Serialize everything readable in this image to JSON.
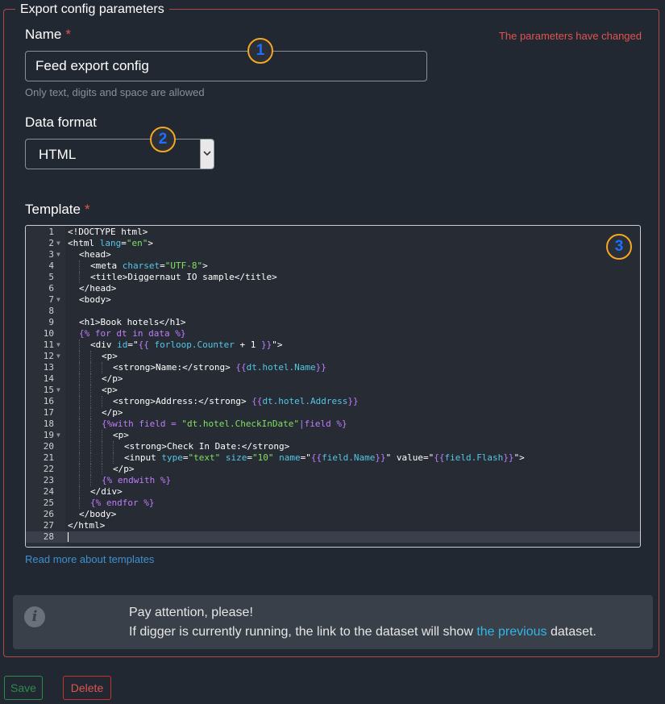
{
  "form": {
    "legend": "Export config parameters",
    "name_label": "Name",
    "required_mark": "*",
    "changed_notice": "The parameters have changed",
    "name_value": "Feed export config",
    "name_hint": "Only text, digits and space are allowed",
    "format_label": "Data format",
    "format_value": "HTML",
    "template_label": "Template",
    "read_more": "Read more about templates"
  },
  "badges": [
    "1",
    "2",
    "3"
  ],
  "editor": {
    "lines": [
      {
        "n": "1",
        "fold": false,
        "indent": 0,
        "parts": [
          [
            "&lt;!DOCTYPE html&gt;",
            ""
          ]
        ]
      },
      {
        "n": "2",
        "fold": true,
        "indent": 0,
        "parts": [
          [
            "<html ",
            ""
          ],
          [
            "lang",
            "attr"
          ],
          [
            "=",
            ""
          ],
          [
            "\"en\"",
            "str"
          ],
          [
            ">",
            ""
          ]
        ]
      },
      {
        "n": "3",
        "fold": true,
        "indent": 1,
        "parts": [
          [
            "<head>",
            ""
          ]
        ]
      },
      {
        "n": "4",
        "fold": false,
        "indent": 2,
        "parts": [
          [
            "<meta ",
            ""
          ],
          [
            "charset",
            "attr"
          ],
          [
            "=",
            ""
          ],
          [
            "\"UTF-8\"",
            "str"
          ],
          [
            ">",
            ""
          ]
        ]
      },
      {
        "n": "5",
        "fold": false,
        "indent": 2,
        "parts": [
          [
            "<title>Diggernaut IO sample</title>",
            ""
          ]
        ]
      },
      {
        "n": "6",
        "fold": false,
        "indent": 1,
        "parts": [
          [
            "</head>",
            ""
          ]
        ]
      },
      {
        "n": "7",
        "fold": true,
        "indent": 1,
        "parts": [
          [
            "<body>",
            ""
          ]
        ]
      },
      {
        "n": "8",
        "fold": false,
        "indent": 0,
        "parts": []
      },
      {
        "n": "9",
        "fold": false,
        "indent": 1,
        "parts": [
          [
            "<h1>Book hotels</h1>",
            ""
          ]
        ]
      },
      {
        "n": "10",
        "fold": false,
        "indent": 1,
        "parts": [
          [
            "{% for dt in data %}",
            "tpl"
          ]
        ]
      },
      {
        "n": "11",
        "fold": true,
        "indent": 2,
        "parts": [
          [
            "<div ",
            ""
          ],
          [
            "id",
            "attr"
          ],
          [
            "=\"",
            ""
          ],
          [
            "{{ ",
            "tpl"
          ],
          [
            "forloop.Counter",
            "var"
          ],
          [
            " + 1 ",
            ""
          ],
          [
            "}}",
            "tpl"
          ],
          [
            "\">",
            ""
          ]
        ]
      },
      {
        "n": "12",
        "fold": true,
        "indent": 3,
        "parts": [
          [
            "<p>",
            ""
          ]
        ]
      },
      {
        "n": "13",
        "fold": false,
        "indent": 4,
        "parts": [
          [
            "<strong>Name:</strong> ",
            ""
          ],
          [
            "{{",
            "tpl"
          ],
          [
            "dt.hotel.Name",
            "var"
          ],
          [
            "}}",
            "tpl"
          ]
        ]
      },
      {
        "n": "14",
        "fold": false,
        "indent": 3,
        "parts": [
          [
            "</p>",
            ""
          ]
        ]
      },
      {
        "n": "15",
        "fold": true,
        "indent": 3,
        "parts": [
          [
            "<p>",
            ""
          ]
        ]
      },
      {
        "n": "16",
        "fold": false,
        "indent": 4,
        "parts": [
          [
            "<strong>Address:</strong> ",
            ""
          ],
          [
            "{{",
            "tpl"
          ],
          [
            "dt.hotel.Address",
            "var"
          ],
          [
            "}}",
            "tpl"
          ]
        ]
      },
      {
        "n": "17",
        "fold": false,
        "indent": 3,
        "parts": [
          [
            "</p>",
            ""
          ]
        ]
      },
      {
        "n": "18",
        "fold": false,
        "indent": 3,
        "parts": [
          [
            "{%with field = ",
            "tpl"
          ],
          [
            "\"dt.hotel.CheckInDate\"",
            "str"
          ],
          [
            "|field %}",
            "tpl"
          ]
        ]
      },
      {
        "n": "19",
        "fold": true,
        "indent": 4,
        "parts": [
          [
            "<p>",
            ""
          ]
        ]
      },
      {
        "n": "20",
        "fold": false,
        "indent": 5,
        "parts": [
          [
            "<strong>Check In Date:</strong>",
            ""
          ]
        ]
      },
      {
        "n": "21",
        "fold": false,
        "indent": 5,
        "parts": [
          [
            "<input ",
            ""
          ],
          [
            "type",
            "attr"
          ],
          [
            "=",
            ""
          ],
          [
            "\"text\"",
            "str"
          ],
          [
            " ",
            ""
          ],
          [
            "size",
            "attr"
          ],
          [
            "=",
            ""
          ],
          [
            "\"10\"",
            "str"
          ],
          [
            " ",
            ""
          ],
          [
            "name",
            "attr"
          ],
          [
            "=\"",
            ""
          ],
          [
            "{{",
            "tpl"
          ],
          [
            "field.Name",
            "var"
          ],
          [
            "}}",
            "tpl"
          ],
          [
            "\" value=\"",
            ""
          ],
          [
            "{{",
            "tpl"
          ],
          [
            "field.Flash",
            "var"
          ],
          [
            "}}",
            "tpl"
          ],
          [
            "\">",
            ""
          ]
        ]
      },
      {
        "n": "22",
        "fold": false,
        "indent": 4,
        "parts": [
          [
            "</p>",
            ""
          ]
        ]
      },
      {
        "n": "23",
        "fold": false,
        "indent": 3,
        "parts": [
          [
            "{% endwith %}",
            "tpl"
          ]
        ]
      },
      {
        "n": "24",
        "fold": false,
        "indent": 2,
        "parts": [
          [
            "</div>",
            ""
          ]
        ]
      },
      {
        "n": "25",
        "fold": false,
        "indent": 2,
        "parts": [
          [
            "{% endfor %}",
            "tpl"
          ]
        ]
      },
      {
        "n": "26",
        "fold": false,
        "indent": 1,
        "parts": [
          [
            "</body>",
            ""
          ]
        ]
      },
      {
        "n": "27",
        "fold": false,
        "indent": 0,
        "parts": [
          [
            "</html>",
            ""
          ]
        ]
      },
      {
        "n": "28",
        "fold": false,
        "indent": 0,
        "parts": [],
        "active": true
      }
    ]
  },
  "alert": {
    "icon": "info-icon",
    "title": "Pay attention, please!",
    "text_before": "If digger is currently running, the link to the dataset will show ",
    "link": "the previous",
    "text_after": " dataset."
  },
  "buttons": {
    "save": "Save",
    "delete": "Delete"
  },
  "colors": {
    "accent_red": "#e0544f",
    "link_blue": "#3f90d0",
    "badge_orange": "#f5a623",
    "badge_text": "#1e6fff",
    "save_green": "#2e8b4a"
  }
}
